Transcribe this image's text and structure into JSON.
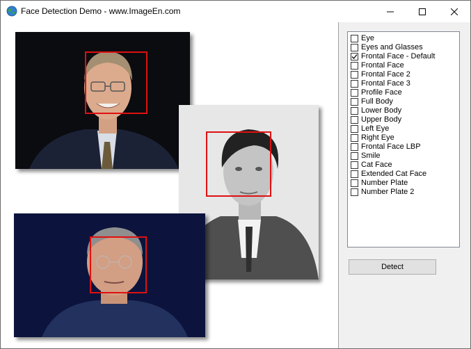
{
  "window": {
    "title": "Face Detection Demo - www.ImageEn.com",
    "icon": "globe-app-icon",
    "controls": [
      "minimize-icon",
      "maximize-icon",
      "close-icon"
    ]
  },
  "detection": {
    "highlight_color": "#e01010"
  },
  "classifiers": {
    "items": [
      {
        "label": "Eye",
        "checked": false
      },
      {
        "label": "Eyes and Glasses",
        "checked": false
      },
      {
        "label": "Frontal Face - Default",
        "checked": true
      },
      {
        "label": "Frontal Face",
        "checked": false
      },
      {
        "label": "Frontal Face 2",
        "checked": false
      },
      {
        "label": "Frontal Face 3",
        "checked": false
      },
      {
        "label": "Profile Face",
        "checked": false
      },
      {
        "label": "Full Body",
        "checked": false
      },
      {
        "label": "Lower Body",
        "checked": false
      },
      {
        "label": "Upper Body",
        "checked": false
      },
      {
        "label": "Left Eye",
        "checked": false
      },
      {
        "label": "Right Eye",
        "checked": false
      },
      {
        "label": "Frontal Face LBP",
        "checked": false
      },
      {
        "label": "Smile",
        "checked": false
      },
      {
        "label": "Cat Face",
        "checked": false
      },
      {
        "label": "Extended Cat Face",
        "checked": false
      },
      {
        "label": "Number Plate",
        "checked": false
      },
      {
        "label": "Number Plate 2",
        "checked": false
      }
    ]
  },
  "actions": {
    "detect_label": "Detect"
  }
}
